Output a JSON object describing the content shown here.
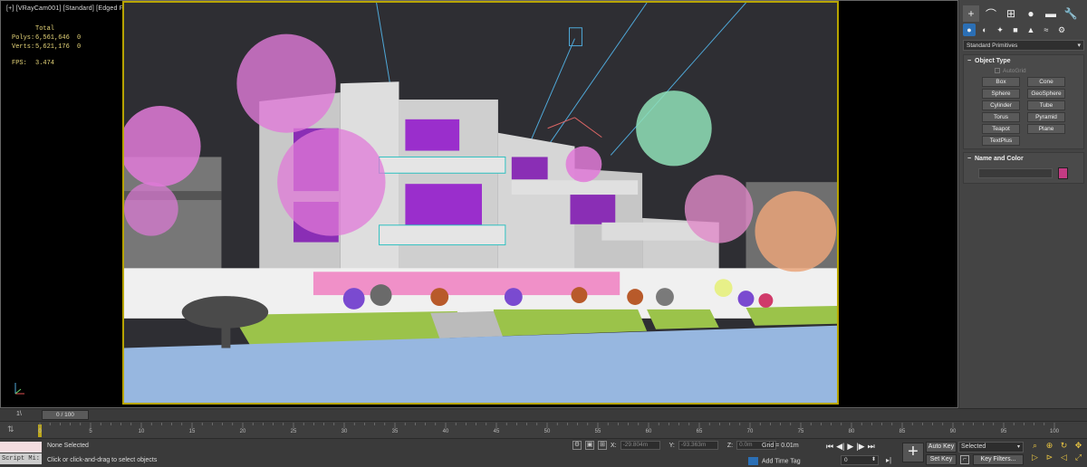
{
  "viewport": {
    "label": "[+] [VRayCam001] [Standard] [Edged Faces]",
    "stats": {
      "header": "Total",
      "rows": [
        {
          "key": "Polys:",
          "total": "6,561,646",
          "sel": "0"
        },
        {
          "key": "Verts:",
          "total": "5,621,176",
          "sel": "0"
        }
      ],
      "fps_label": "FPS:",
      "fps_value": "3.474"
    }
  },
  "command_panel": {
    "tabs": [
      {
        "icon": "plus-icon",
        "glyph": "+"
      },
      {
        "icon": "curve-icon",
        "glyph": "⌒"
      },
      {
        "icon": "hierarchy-icon",
        "glyph": "⊞"
      },
      {
        "icon": "motion-icon",
        "glyph": "●"
      },
      {
        "icon": "display-icon",
        "glyph": "▬"
      },
      {
        "icon": "utilities-icon",
        "glyph": "🔧"
      }
    ],
    "subtabs": [
      {
        "icon": "geometry-icon",
        "glyph": "●"
      },
      {
        "icon": "shapes-icon",
        "glyph": "◐"
      },
      {
        "icon": "lights-icon",
        "glyph": "✦"
      },
      {
        "icon": "cameras-icon",
        "glyph": "■"
      },
      {
        "icon": "helpers-icon",
        "glyph": "▲"
      },
      {
        "icon": "spacewarps-icon",
        "glyph": "≈"
      },
      {
        "icon": "systems-icon",
        "glyph": "⚙"
      }
    ],
    "dropdown_value": "Standard Primitives",
    "object_type": {
      "title": "Object Type",
      "autogrid": "AutoGrid",
      "buttons": [
        "Box",
        "Cone",
        "Sphere",
        "GeoSphere",
        "Cylinder",
        "Tube",
        "Torus",
        "Pyramid",
        "Teapot",
        "Plane",
        "TextPlus"
      ]
    },
    "name_color": {
      "title": "Name and Color",
      "swatch_color": "#c43b83"
    }
  },
  "timeline": {
    "slider_label": "0 / 100",
    "lead_label": "1\\",
    "ticks": [
      "0",
      "5",
      "10",
      "15",
      "20",
      "25",
      "30",
      "35",
      "40",
      "45",
      "50",
      "55",
      "60",
      "65",
      "70",
      "75",
      "80",
      "85",
      "90",
      "95",
      "100"
    ]
  },
  "status": {
    "script_label": "Script Mi:",
    "selection": "None Selected",
    "prompt": "Click or click-and-drag to select objects",
    "x_label": "X:",
    "x_value": "-29.804m",
    "y_label": "Y:",
    "y_value": "-93.363m",
    "z_label": "Z:",
    "z_value": "0.0m",
    "grid": "Grid = 0.01m",
    "add_time_tag": "Add Time Tag",
    "frame_value": "0",
    "auto_key": "Auto Key",
    "set_key": "Set Key",
    "selected_dropdown": "Selected",
    "key_filters": "Key Filters..."
  }
}
